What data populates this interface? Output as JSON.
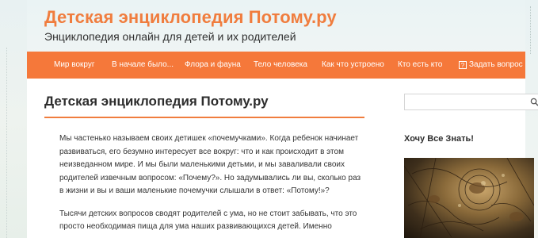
{
  "header": {
    "site_title": "Детская энциклопедия Потому.ру",
    "site_description": "Энциклопедия онлайн для детей и их родителей"
  },
  "nav": {
    "items": [
      {
        "label": "Мир вокруг"
      },
      {
        "label": "В начале было..."
      },
      {
        "label": "Флора и фауна"
      },
      {
        "label": "Тело человека"
      },
      {
        "label": "Как что устроено"
      },
      {
        "label": "Кто есть кто"
      },
      {
        "label": "Задать вопрос",
        "icon": "question-icon"
      }
    ]
  },
  "main": {
    "title": "Детская энциклопедия Потому.ру",
    "paragraphs": [
      "Мы частенько называем своих детишек «почемучками». Когда ребенок начинает развиваться, его безумно интересует все вокруг: что и как происходит в этом неизведанном мире. И мы были маленькими детьми, и мы заваливали своих родителей извечным вопросом: «Почему?». Но задумывались ли вы, сколько раз в жизни и вы и ваши маленькие почемучки слышали в ответ: «Потому!»?",
      "Тысячи детских вопросов сводят родителей с ума, но не стоит забывать, что это просто необходимая пища для ума наших развивающихся детей. Именно"
    ]
  },
  "sidebar": {
    "search": {
      "placeholder": "",
      "icon": "search-icon"
    },
    "widget_title": "Хочу Все Знать!"
  },
  "colors": {
    "accent": "#f5783a",
    "title": "#f07d3e",
    "text": "#333333"
  }
}
